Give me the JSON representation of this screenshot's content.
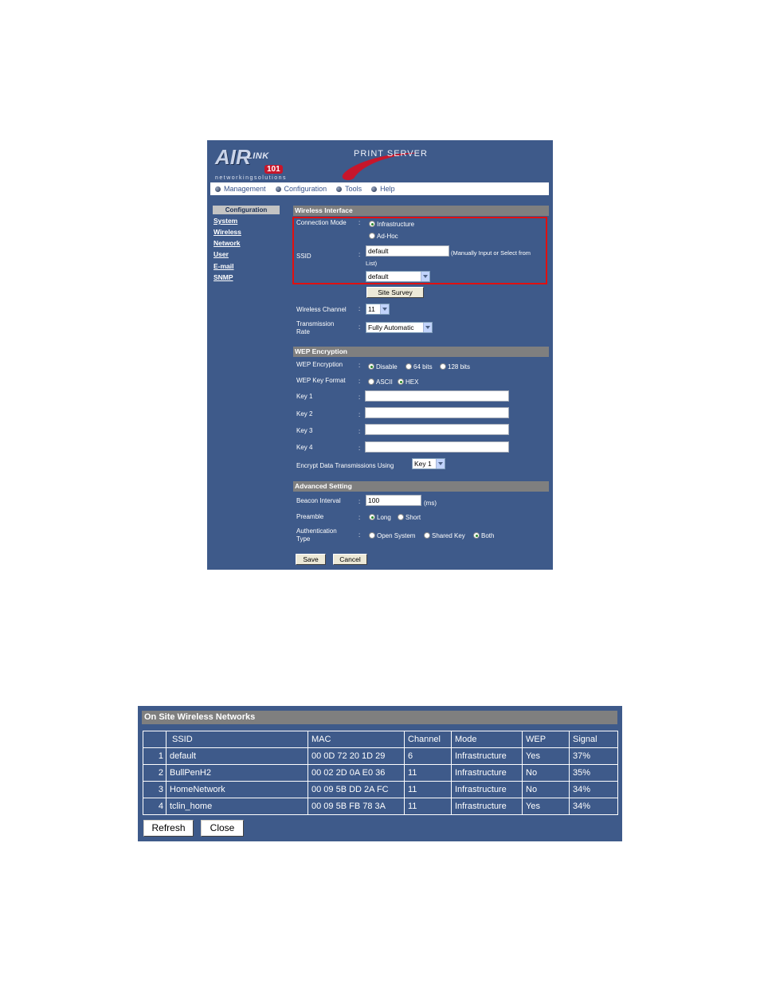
{
  "header": {
    "logo_main": "AIR",
    "logo_sub": "LINK",
    "logo_num": "101",
    "logo_tag": "networkingsolutions",
    "product": "PRINT SERVER"
  },
  "menu": [
    "Management",
    "Configuration",
    "Tools",
    "Help"
  ],
  "sidebar": {
    "heading": "Configuration",
    "items": [
      "System",
      "Wireless",
      "Network",
      "User",
      "E-mail",
      "SNMP"
    ]
  },
  "wireless_interface": {
    "title": "Wireless Interface",
    "connection_mode_label": "Connection Mode",
    "mode_options": [
      "Infrastructure",
      "Ad-Hoc"
    ],
    "ssid_label": "SSID",
    "ssid_value": "default",
    "ssid_hint": "(Manually Input or Select from",
    "ssid_hint_cont": "List)",
    "ssid_select": "default",
    "site_survey_label": "Site Survey",
    "channel_label": "Wireless Channel",
    "channel_value": "11",
    "rate_label_1": "Transmission",
    "rate_label_2": "Rate",
    "rate_value": "Fully Automatic"
  },
  "wep": {
    "title": "WEP Encryption",
    "encryption_label": "WEP Encryption",
    "encryption_options": [
      "Disable",
      "64 bits",
      "128 bits"
    ],
    "key_format_label": "WEP Key Format",
    "key_format_options": [
      "ASCII",
      "HEX"
    ],
    "keys": [
      "Key 1",
      "Key 2",
      "Key 3",
      "Key 4"
    ],
    "encrypt_using_label": "Encrypt Data Transmissions Using",
    "encrypt_using_value": "Key 1"
  },
  "advanced": {
    "title": "Advanced Setting",
    "beacon_label": "Beacon Interval",
    "beacon_value": "100",
    "beacon_unit": "(ms)",
    "preamble_label": "Preamble",
    "preamble_options": [
      "Long",
      "Short"
    ],
    "auth_label_1": "Authentication",
    "auth_label_2": "Type",
    "auth_options": [
      "Open System",
      "Shared Key",
      "Both"
    ]
  },
  "actions": {
    "save": "Save",
    "cancel": "Cancel"
  },
  "survey": {
    "title": "On Site Wireless Networks",
    "columns": [
      "",
      "SSID",
      "MAC",
      "Channel",
      "Mode",
      "WEP",
      "Signal"
    ],
    "rows": [
      [
        "1",
        "default",
        "00 0D 72 20 1D 29",
        "6",
        "Infrastructure",
        "Yes",
        "37%"
      ],
      [
        "2",
        "BullPenH2",
        "00 02 2D 0A E0 36",
        "11",
        "Infrastructure",
        "No",
        "35%"
      ],
      [
        "3",
        "HomeNetwork",
        "00 09 5B DD 2A FC",
        "11",
        "Infrastructure",
        "No",
        "34%"
      ],
      [
        "4",
        "tclin_home",
        "00 09 5B FB 78 3A",
        "11",
        "Infrastructure",
        "Yes",
        "34%"
      ]
    ],
    "refresh": "Refresh",
    "close": "Close"
  },
  "colors": {
    "panel": "#3e5a8a",
    "section_bar": "#7f7f7f",
    "highlight": "#e01010"
  }
}
